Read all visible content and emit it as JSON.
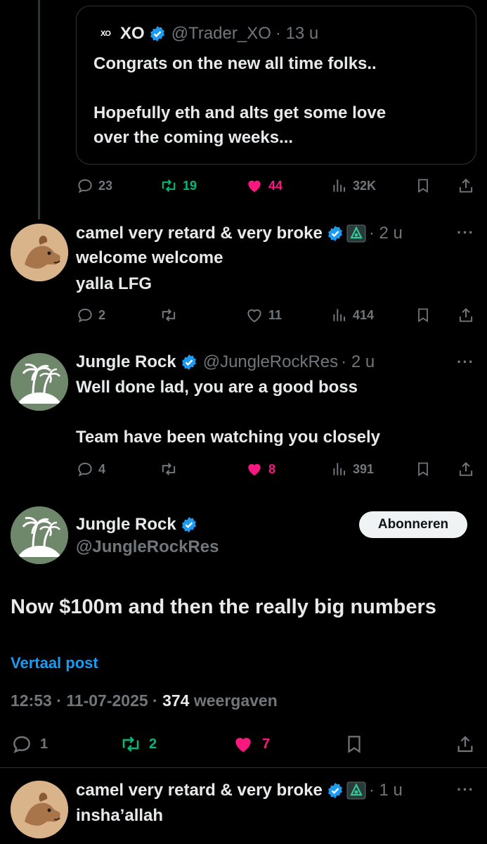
{
  "quote": {
    "avatar_text": "XO",
    "name": "XO",
    "handle": "@Trader_XO",
    "time": "· 13 u",
    "line1": "Congrats on the new all time folks..",
    "line2": "Hopefully eth and alts get some love",
    "line3": "over the coming weeks...",
    "stats": {
      "replies": "23",
      "reposts": "19",
      "likes": "44",
      "views": "32K"
    }
  },
  "reply1": {
    "name": "camel very retard & very broke",
    "time": "· 2 u",
    "line1": "welcome welcome",
    "line2": "yalla LFG",
    "stats": {
      "replies": "2",
      "reposts": "",
      "likes": "11",
      "views": "414"
    }
  },
  "reply2": {
    "name": "Jungle Rock",
    "handle": "@JungleRockRes",
    "time": "· 2 u",
    "line1": "Well done lad, you are a good boss",
    "line2": "Team have been watching you closely",
    "stats": {
      "replies": "4",
      "reposts": "",
      "likes": "8",
      "views": "391"
    }
  },
  "main": {
    "name": "Jungle Rock",
    "handle": "@JungleRockRes",
    "follow_label": "Abonneren",
    "text": "Now $100m and then the really big numbers",
    "translate": "Vertaal post",
    "timestamp": "12:53 · 11-07-2025 · ",
    "views_count": "374",
    "views_label": " weergaven",
    "stats": {
      "replies": "1",
      "reposts": "2",
      "likes": "7"
    }
  },
  "reply3": {
    "name": "camel very retard & very broke",
    "time": "· 1 u",
    "line1": "insha’allah"
  },
  "colors": {
    "accent": "#1d9bf0",
    "like": "#f91880",
    "repost": "#00ba7c",
    "muted": "#71767b"
  },
  "more_glyph": "···"
}
